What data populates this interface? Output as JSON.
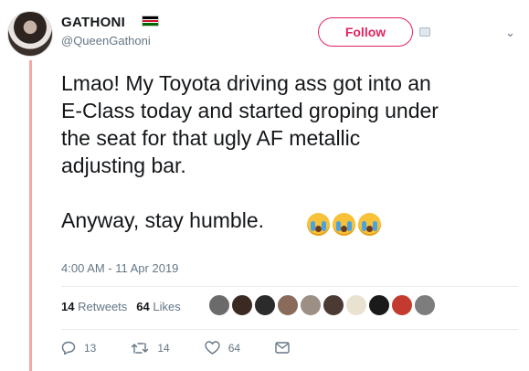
{
  "user": {
    "name": "GATHONI",
    "handle": "@QueenGathoni"
  },
  "follow_label": "Follow",
  "tweet": {
    "line1": "Lmao! My Toyota driving ass got into an\nE-Class today and started groping under\nthe seat for that ugly AF metallic\nadjusting bar.\n\nAnyway, stay humble.",
    "emoji": [
      "loudly-crying-face",
      "loudly-crying-face",
      "loudly-crying-face"
    ]
  },
  "timestamp": "4:00 AM - 11 Apr 2019",
  "stats": {
    "retweets_count": "14",
    "retweets_label": "Retweets",
    "likes_count": "64",
    "likes_label": "Likes"
  },
  "liker_colors": [
    "#6b6b6b",
    "#3b2a22",
    "#2b2b2b",
    "#8a6a5a",
    "#9c8f86",
    "#4a3a33",
    "#e9e2d0",
    "#1a1a1a",
    "#c33b2e",
    "#7d7d7d"
  ],
  "actions": {
    "reply_count": "13",
    "retweet_count": "14",
    "like_count": "64"
  },
  "colors": {
    "follow_accent": "#e0245e",
    "thread_line": "#f3a8a8",
    "secondary_text": "#657786"
  }
}
